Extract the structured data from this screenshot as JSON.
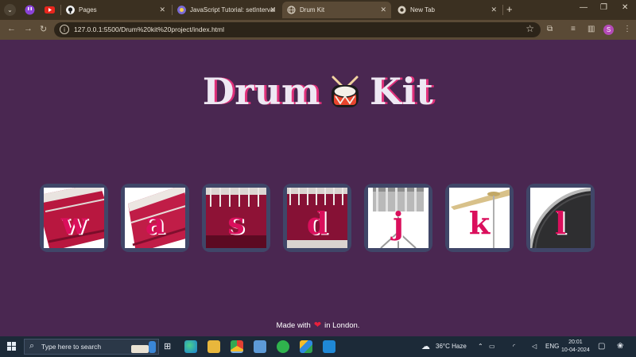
{
  "browser": {
    "tabs": [
      {
        "label": "Pages",
        "favicon": "github-icon"
      },
      {
        "label": "JavaScript Tutorial: setInterval",
        "favicon": "tutorial-icon"
      },
      {
        "label": "Drum Kit",
        "favicon": "globe-icon"
      },
      {
        "label": "New Tab",
        "favicon": "chrome-icon"
      }
    ],
    "address": "127.0.0.1:5500/Drum%20kit%20project/index.html",
    "profile_initial": "S"
  },
  "page": {
    "title_left": "Drum",
    "title_right": "Kit",
    "drums": [
      {
        "key": "w",
        "instrument": "tom-1"
      },
      {
        "key": "a",
        "instrument": "tom-2"
      },
      {
        "key": "s",
        "instrument": "tom-3"
      },
      {
        "key": "d",
        "instrument": "tom-4"
      },
      {
        "key": "j",
        "instrument": "snare"
      },
      {
        "key": "k",
        "instrument": "crash"
      },
      {
        "key": "l",
        "instrument": "kick-bass"
      }
    ],
    "footer_before": "Made with",
    "footer_after": "in London."
  },
  "taskbar": {
    "search_placeholder": "Type here to search",
    "weather": "36°C  Haze",
    "language": "ENG",
    "time": "20:01",
    "date": "10-04-2024"
  },
  "colors": {
    "background": "#4a2751",
    "key_letter": "#da0f5c",
    "tile_border": "#404668",
    "title_shadow": "#e0307a"
  }
}
